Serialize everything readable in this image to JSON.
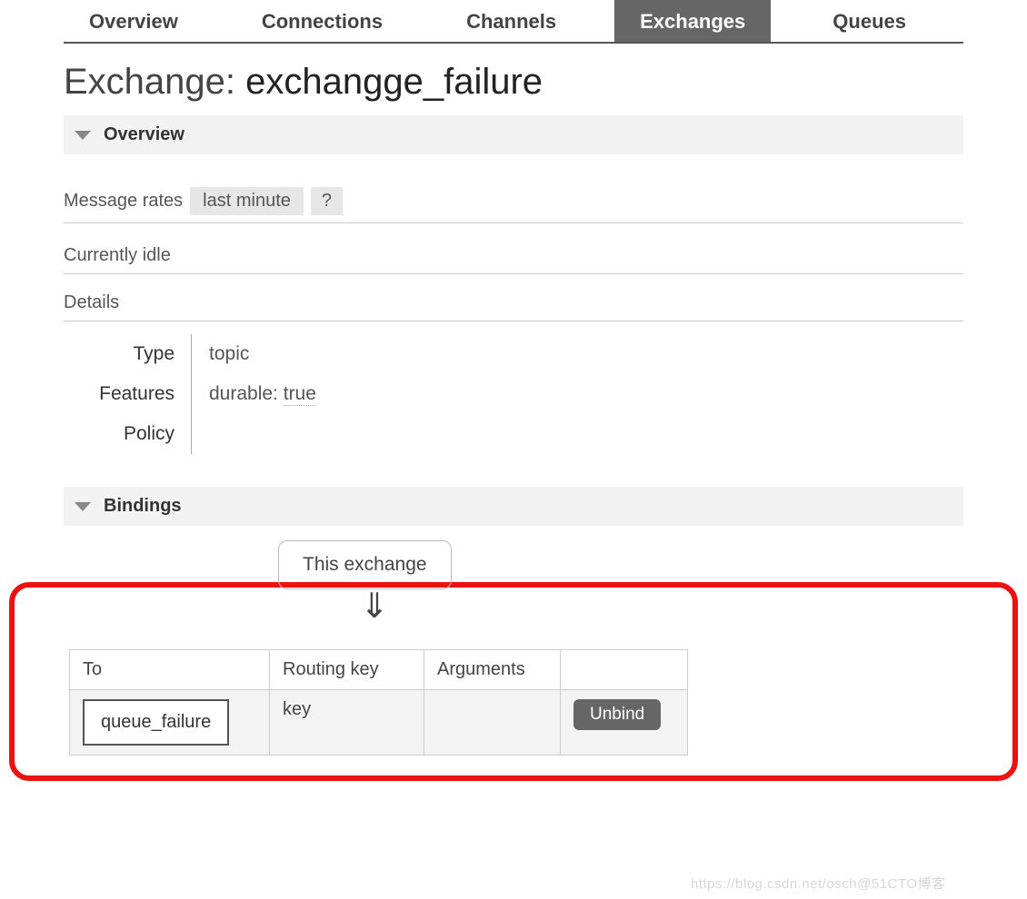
{
  "tabs": {
    "overview": "Overview",
    "connections": "Connections",
    "channels": "Channels",
    "exchanges": "Exchanges",
    "queues": "Queues",
    "active": "exchanges"
  },
  "title": {
    "prefix": "Exchange: ",
    "name": "exchangge_failure"
  },
  "sections": {
    "overview": "Overview",
    "bindings": "Bindings"
  },
  "rates": {
    "label": "Message rates",
    "range": "last minute",
    "help": "?"
  },
  "status": {
    "idle": "Currently idle",
    "details_header": "Details"
  },
  "details": {
    "type_label": "Type",
    "type_value": "topic",
    "features_label": "Features",
    "features_key": "durable:",
    "features_value": "true",
    "policy_label": "Policy",
    "policy_value": ""
  },
  "bindings": {
    "this_exchange": "This exchange",
    "headers": {
      "to": "To",
      "routing_key": "Routing key",
      "arguments": "Arguments"
    },
    "rows": [
      {
        "to": "queue_failure",
        "routing_key": "key",
        "arguments": "",
        "action": "Unbind"
      }
    ]
  },
  "watermark": "https://blog.csdn.net/osch@51CTO博客"
}
